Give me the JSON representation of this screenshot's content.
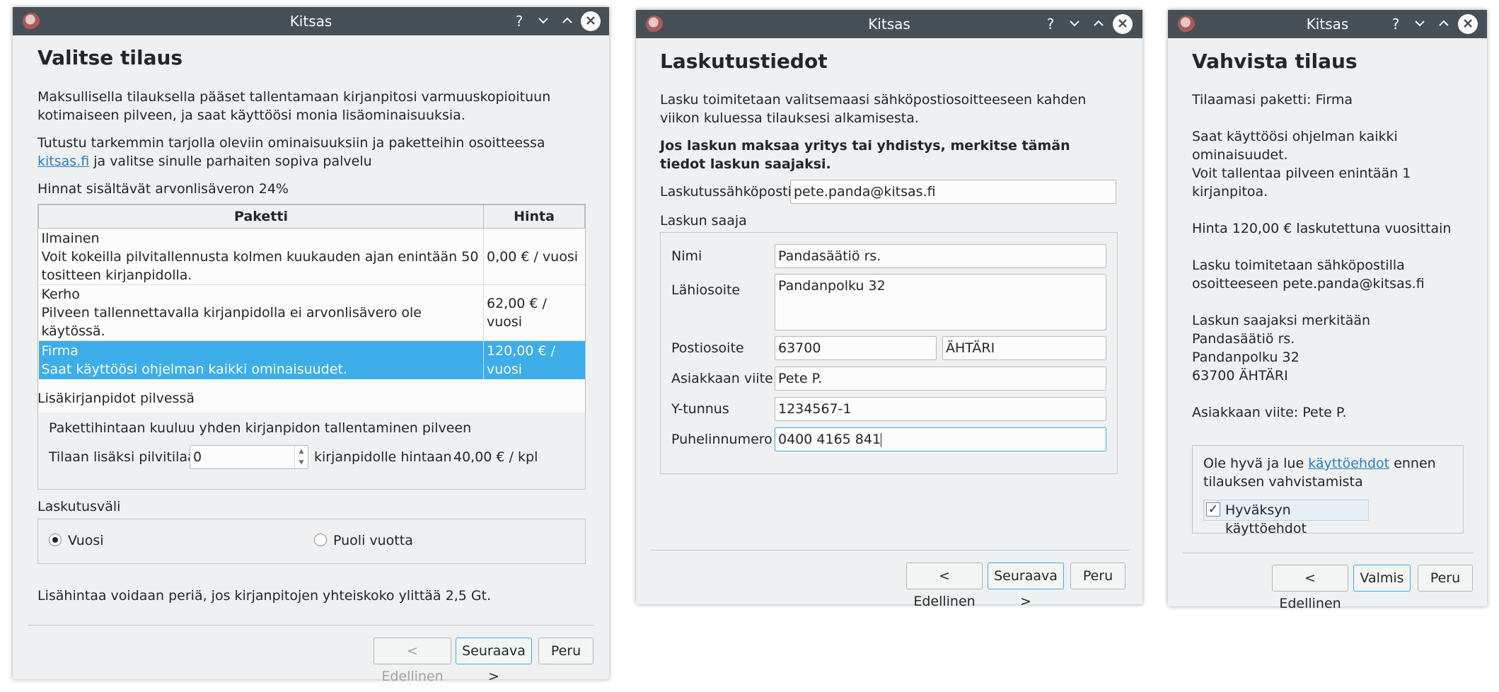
{
  "app_title": "Kitsas",
  "title_buttons": {
    "help": "?",
    "minimize": "⌄",
    "maximize": "⌃",
    "close": "✕"
  },
  "w1": {
    "heading": "Valitse tilaus",
    "intro": "Maksullisella tilauksella pääset tallentamaan kirjanpitosi varmuuskopioituun kotimaiseen pilveen, ja saat käyttöösi monia lisäominaisuuksia.",
    "info_before": "Tutustu tarkemmin tarjolla oleviin ominaisuuksiin ja paketteihin osoitteessa ",
    "info_link": "kitsas.fi",
    "info_after": " ja valitse sinulle parhaiten sopiva palvelu",
    "vat_note": "Hinnat sisältävät arvonlisäveron 24%",
    "table_headers": [
      "Paketti",
      "Hinta"
    ],
    "packages": [
      {
        "name": "Ilmainen",
        "desc": "Voit kokeilla pilvitallennusta kolmen kuukauden ajan enintään 50 tositteen kirjanpidolla.",
        "price": "0,00 € / vuosi"
      },
      {
        "name": "Kerho",
        "desc": "Pilveen tallennettavalla kirjanpidolla ei arvonlisävero ole käytössä.",
        "price": "62,00 € / vuosi"
      },
      {
        "name": "Firma",
        "desc": "Saat käyttöösi ohjelman kaikki ominaisuudet.",
        "price": "120,00 € / vuosi",
        "selected": true
      }
    ],
    "extra_title": "Lisäkirjanpidot pilvessä",
    "extra_note": "Pakettihintaan kuuluu yhden kirjanpidon tallentaminen pilveen",
    "extra_order_label": "Tilaan lisäksi pilvitilaa",
    "extra_value": "0",
    "extra_price_label": "kirjanpidolle hintaan",
    "extra_price": "40,00 € / kpl",
    "interval_title": "Laskutusväli",
    "interval_options": [
      "Vuosi",
      "Puoli vuotta"
    ],
    "interval_selected": 0,
    "size_note": "Lisähintaa voidaan periä, jos kirjanpitojen yhteiskoko ylittää 2,5 Gt.",
    "btn_back": "< Edellinen",
    "btn_next": "Seuraava >",
    "btn_cancel": "Peru"
  },
  "w2": {
    "heading": "Laskutustiedot",
    "intro": "Lasku toimitetaan valitsemaasi sähköpostiosoitteeseen kahden viikon kuluessa tilauksesi alkamisesta.",
    "notice": "Jos laskun maksaa yritys tai yhdistys, merkitse tämän tiedot laskun saajaksi.",
    "email_label": "Laskutussähköposti",
    "email_value": "pete.panda@kitsas.fi",
    "recipient_title": "Laskun saaja",
    "name_label": "Nimi",
    "name_value": "Pandasäätiö rs.",
    "address_label": "Lähiosoite",
    "address_value": "Pandanpolku 32",
    "postal_label": "Postiosoite",
    "postal_code": "63700",
    "postal_city": "ÄHTÄRI",
    "ref_label": "Asiakkaan viite",
    "ref_value": "Pete P.",
    "ytunnus_label": "Y-tunnus",
    "ytunnus_value": "1234567-1",
    "phone_label": "Puhelinnumero",
    "phone_value": "0400 4165 841",
    "btn_back": "< Edellinen",
    "btn_next": "Seuraava >",
    "btn_cancel": "Peru"
  },
  "w3": {
    "heading": "Vahvista tilaus",
    "summary_lines": [
      "Tilaamasi paketti: Firma",
      "",
      "Saat käyttöösi ohjelman kaikki",
      "ominaisuudet.",
      "Voit tallentaa pilveen enintään 1",
      "kirjanpitoa.",
      "",
      "Hinta 120,00 € laskutettuna vuosittain",
      "",
      "Lasku toimitetaan sähköpostilla",
      "osoitteeseen pete.panda@kitsas.fi",
      "",
      "Laskun saajaksi merkitään",
      "Pandasäätiö rs.",
      "Pandanpolku 32",
      "63700 ÄHTÄRI",
      "",
      "Asiakkaan viite: Pete P."
    ],
    "terms_before": "Ole hyvä ja lue ",
    "terms_link": "käyttöehdot",
    "terms_after": " ennen tilauksen vahvistamista",
    "accept_label": "Hyväksyn käyttöehdot",
    "accept_checked": true,
    "btn_back": "< Edellinen",
    "btn_done": "Valmis",
    "btn_cancel": "Peru"
  }
}
